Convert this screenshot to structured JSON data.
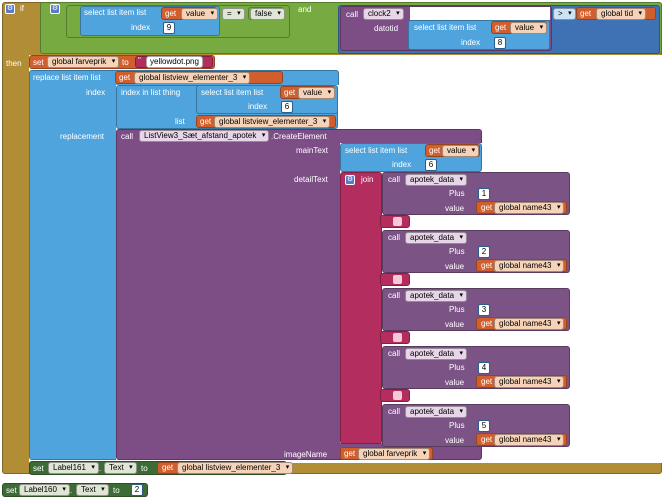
{
  "if_block": {
    "if_label": "if",
    "then_label": "then"
  },
  "cond_left": {
    "select_label": "select list item  list",
    "get": "get",
    "var": "value",
    "index_label": "index",
    "index_val": "9"
  },
  "compare": {
    "op": "=",
    "false_val": "false"
  },
  "and_label": "and",
  "clock_call": {
    "call": "call",
    "component": "clock2",
    "datotid_label": "datotid",
    "select_label": "select list item  list",
    "get": "get",
    "var": "value",
    "index_label": "index",
    "index_val": "8"
  },
  "gt": {
    "op": ">",
    "get": "get",
    "var": "global tid"
  },
  "set1": {
    "set": "set",
    "var": "global farveprik",
    "to": "to",
    "value": "yellowdot.png"
  },
  "replace": {
    "label": "replace list item  list",
    "get": "get",
    "var": "global listview_elementer_3",
    "index_label": "index",
    "index_in_list": "index in list  thing",
    "select_label": "select list item  list",
    "sel_get": "get",
    "sel_var": "value",
    "sel_index_label": "index",
    "sel_index_val": "6",
    "list_label": "list",
    "list_get": "get",
    "list_var": "global listview_elementer_3",
    "replacement_label": "replacement"
  },
  "create": {
    "call": "call",
    "component": "ListView3_Sæt_afstand_apotek",
    "method": ".CreateElement",
    "mainText_label": "mainText",
    "mt_select": "select list item  list",
    "mt_get": "get",
    "mt_var": "value",
    "mt_index_label": "index",
    "mt_index_val": "6",
    "detailText_label": "detailText",
    "join_label": "join",
    "imageName_label": "imageName",
    "img_get": "get",
    "img_var": "global farveprik"
  },
  "apotek_calls": [
    {
      "call": "call",
      "proc": "apotek_data",
      "plus_label": "Plus",
      "plus_val": "1",
      "value_label": "value",
      "get": "get",
      "var": "global name43"
    },
    {
      "call": "call",
      "proc": "apotek_data",
      "plus_label": "Plus",
      "plus_val": "2",
      "value_label": "value",
      "get": "get",
      "var": "global name43"
    },
    {
      "call": "call",
      "proc": "apotek_data",
      "plus_label": "Plus",
      "plus_val": "3",
      "value_label": "value",
      "get": "get",
      "var": "global name43"
    },
    {
      "call": "call",
      "proc": "apotek_data",
      "plus_label": "Plus",
      "plus_val": "4",
      "value_label": "value",
      "get": "get",
      "var": "global name43"
    },
    {
      "call": "call",
      "proc": "apotek_data",
      "plus_label": "Plus",
      "plus_val": "5",
      "value_label": "value",
      "get": "get",
      "var": "global name43"
    }
  ],
  "set_label161": {
    "set": "set",
    "component": "Label161",
    "prop": "Text",
    "to": "to",
    "get": "get",
    "var": "global listview_elementer_3"
  },
  "set_label160": {
    "set": "set",
    "component": "Label160",
    "prop": "Text",
    "to": "to",
    "value": "2"
  },
  "colors": {
    "control": "#b18e35",
    "logic": "#77ab41",
    "list": "#4fa4dd",
    "variable": "#d05f2d",
    "component": "#7d4d86",
    "math": "#3f71b5",
    "text": "#b32d5e",
    "procedure": "#7c5385",
    "setcomp": "#3d6b35"
  }
}
